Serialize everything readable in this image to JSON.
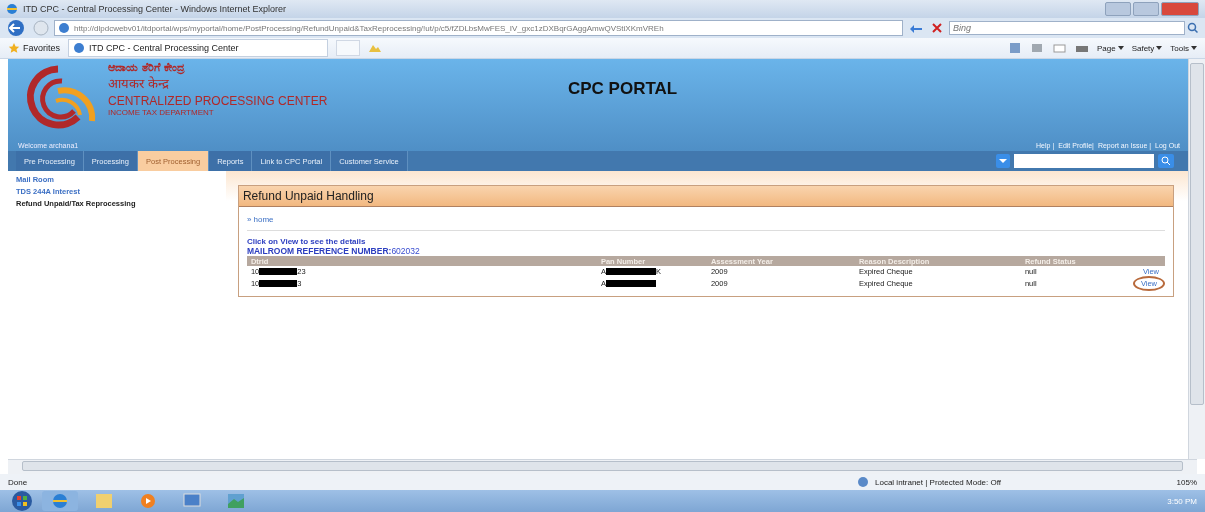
{
  "window": {
    "title": "ITD CPC - Central Processing Center - Windows Internet Explorer"
  },
  "address_bar": {
    "url": "http://dlpdcwebv01/itdportal/wps/myportal/home/PostProcessing/RefundUnpaid&TaxReprocessing/!ut/p/c5/fZDLbsMwFES_IV_gxc1zDXBqrGAggAmwQVStiXKmVREh",
    "search_placeholder": "Bing"
  },
  "favorites_bar": {
    "favorites": "Favorites",
    "tab": "ITD CPC - Central Processing Center",
    "menus": [
      "Page",
      "Safety",
      "Tools"
    ]
  },
  "header": {
    "kannada": "ಆದಾಯ ತೆರಿಗೆ ಕೇಂದ್ರ",
    "hindi": "आयकर केन्द्र",
    "org": "CENTRALIZED PROCESSING CENTER",
    "dept": "INCOME TAX DEPARTMENT",
    "portal": "CPC PORTAL",
    "welcome": "Welcome   archana1",
    "links": [
      "Help |",
      "Edit Profile|",
      "Report an Issue |",
      "Log Out"
    ]
  },
  "tabs": [
    {
      "label": "Pre Processing",
      "selected": false
    },
    {
      "label": "Processing",
      "selected": false
    },
    {
      "label": "Post Processing",
      "selected": true
    },
    {
      "label": "Reports",
      "selected": false
    },
    {
      "label": "Link to CPC Portal",
      "selected": false
    },
    {
      "label": "Customer Service",
      "selected": false
    }
  ],
  "sidebar": {
    "items": [
      {
        "label": "Mail Room",
        "selected": false
      },
      {
        "label": "TDS 244A Interest",
        "selected": false
      },
      {
        "label": "Refund Unpaid/Tax Reprocessing",
        "selected": true
      }
    ]
  },
  "panel": {
    "title": "Refund Unpaid Handling",
    "breadcrumb": "» home",
    "hint": "Click on View to see the details",
    "reference_label": "MAILROOM REFERENCE NUMBER:",
    "reference_value": "602032"
  },
  "table": {
    "columns": [
      "Dtrid",
      "Pan Number",
      "Assessment Year",
      "Reason Description",
      "Refund Status"
    ],
    "rows": [
      {
        "dtrid": {
          "before": "10",
          "after": "23"
        },
        "pan": {
          "before": "A",
          "after": "K"
        },
        "year": "2009",
        "reason": "Expired Cheque",
        "status": "null",
        "action": "View",
        "circled": false
      },
      {
        "dtrid": {
          "before": "10",
          "after": "3"
        },
        "pan": {
          "before": "A"
        },
        "year": "2009",
        "reason": "Expired Cheque",
        "status": "null",
        "action": "View",
        "circled": true
      }
    ]
  },
  "status_bar": {
    "left": "Done",
    "zone": "Local intranet | Protected Mode: Off",
    "zoom": "105%"
  },
  "taskbar": {
    "time": "3:50 PM"
  }
}
